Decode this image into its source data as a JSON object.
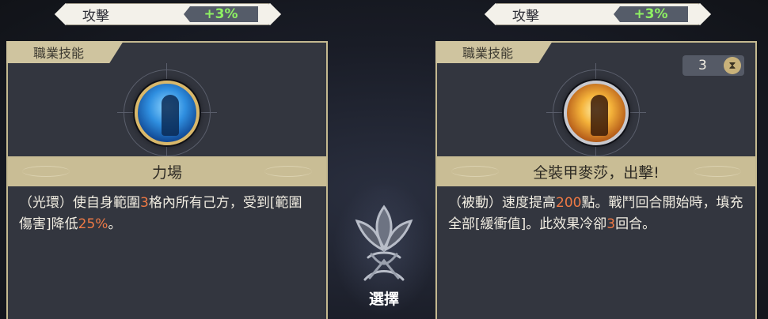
{
  "left_card": {
    "stat": {
      "name": "攻擊",
      "value": "+3%"
    },
    "tag": "職業技能",
    "icon": "force-field-skill-icon",
    "skill_name": "力場",
    "desc": {
      "p1": "（光環）使自身範圍",
      "n1": "3",
      "p2": "格內所有己方，受到[範圍傷害]降低",
      "n2": "25%",
      "p3": "。"
    }
  },
  "right_card": {
    "stat": {
      "name": "攻擊",
      "value": "+3%"
    },
    "tag": "職業技能",
    "cooldown": "3",
    "icon": "full-armor-skill-icon",
    "skill_name": "全裝甲麥莎，出擊!",
    "desc": {
      "p1": "（被動）速度提高",
      "n1": "200",
      "p2": "點。戰鬥回合開始時，填充全部[緩衝值]。此效果冷卻",
      "n2": "3",
      "p3": "回合。"
    }
  },
  "center": {
    "select_label": "選擇"
  },
  "colors": {
    "highlight": "#f07a45",
    "stat_value": "#8ef063",
    "band": "#c9bd95"
  }
}
